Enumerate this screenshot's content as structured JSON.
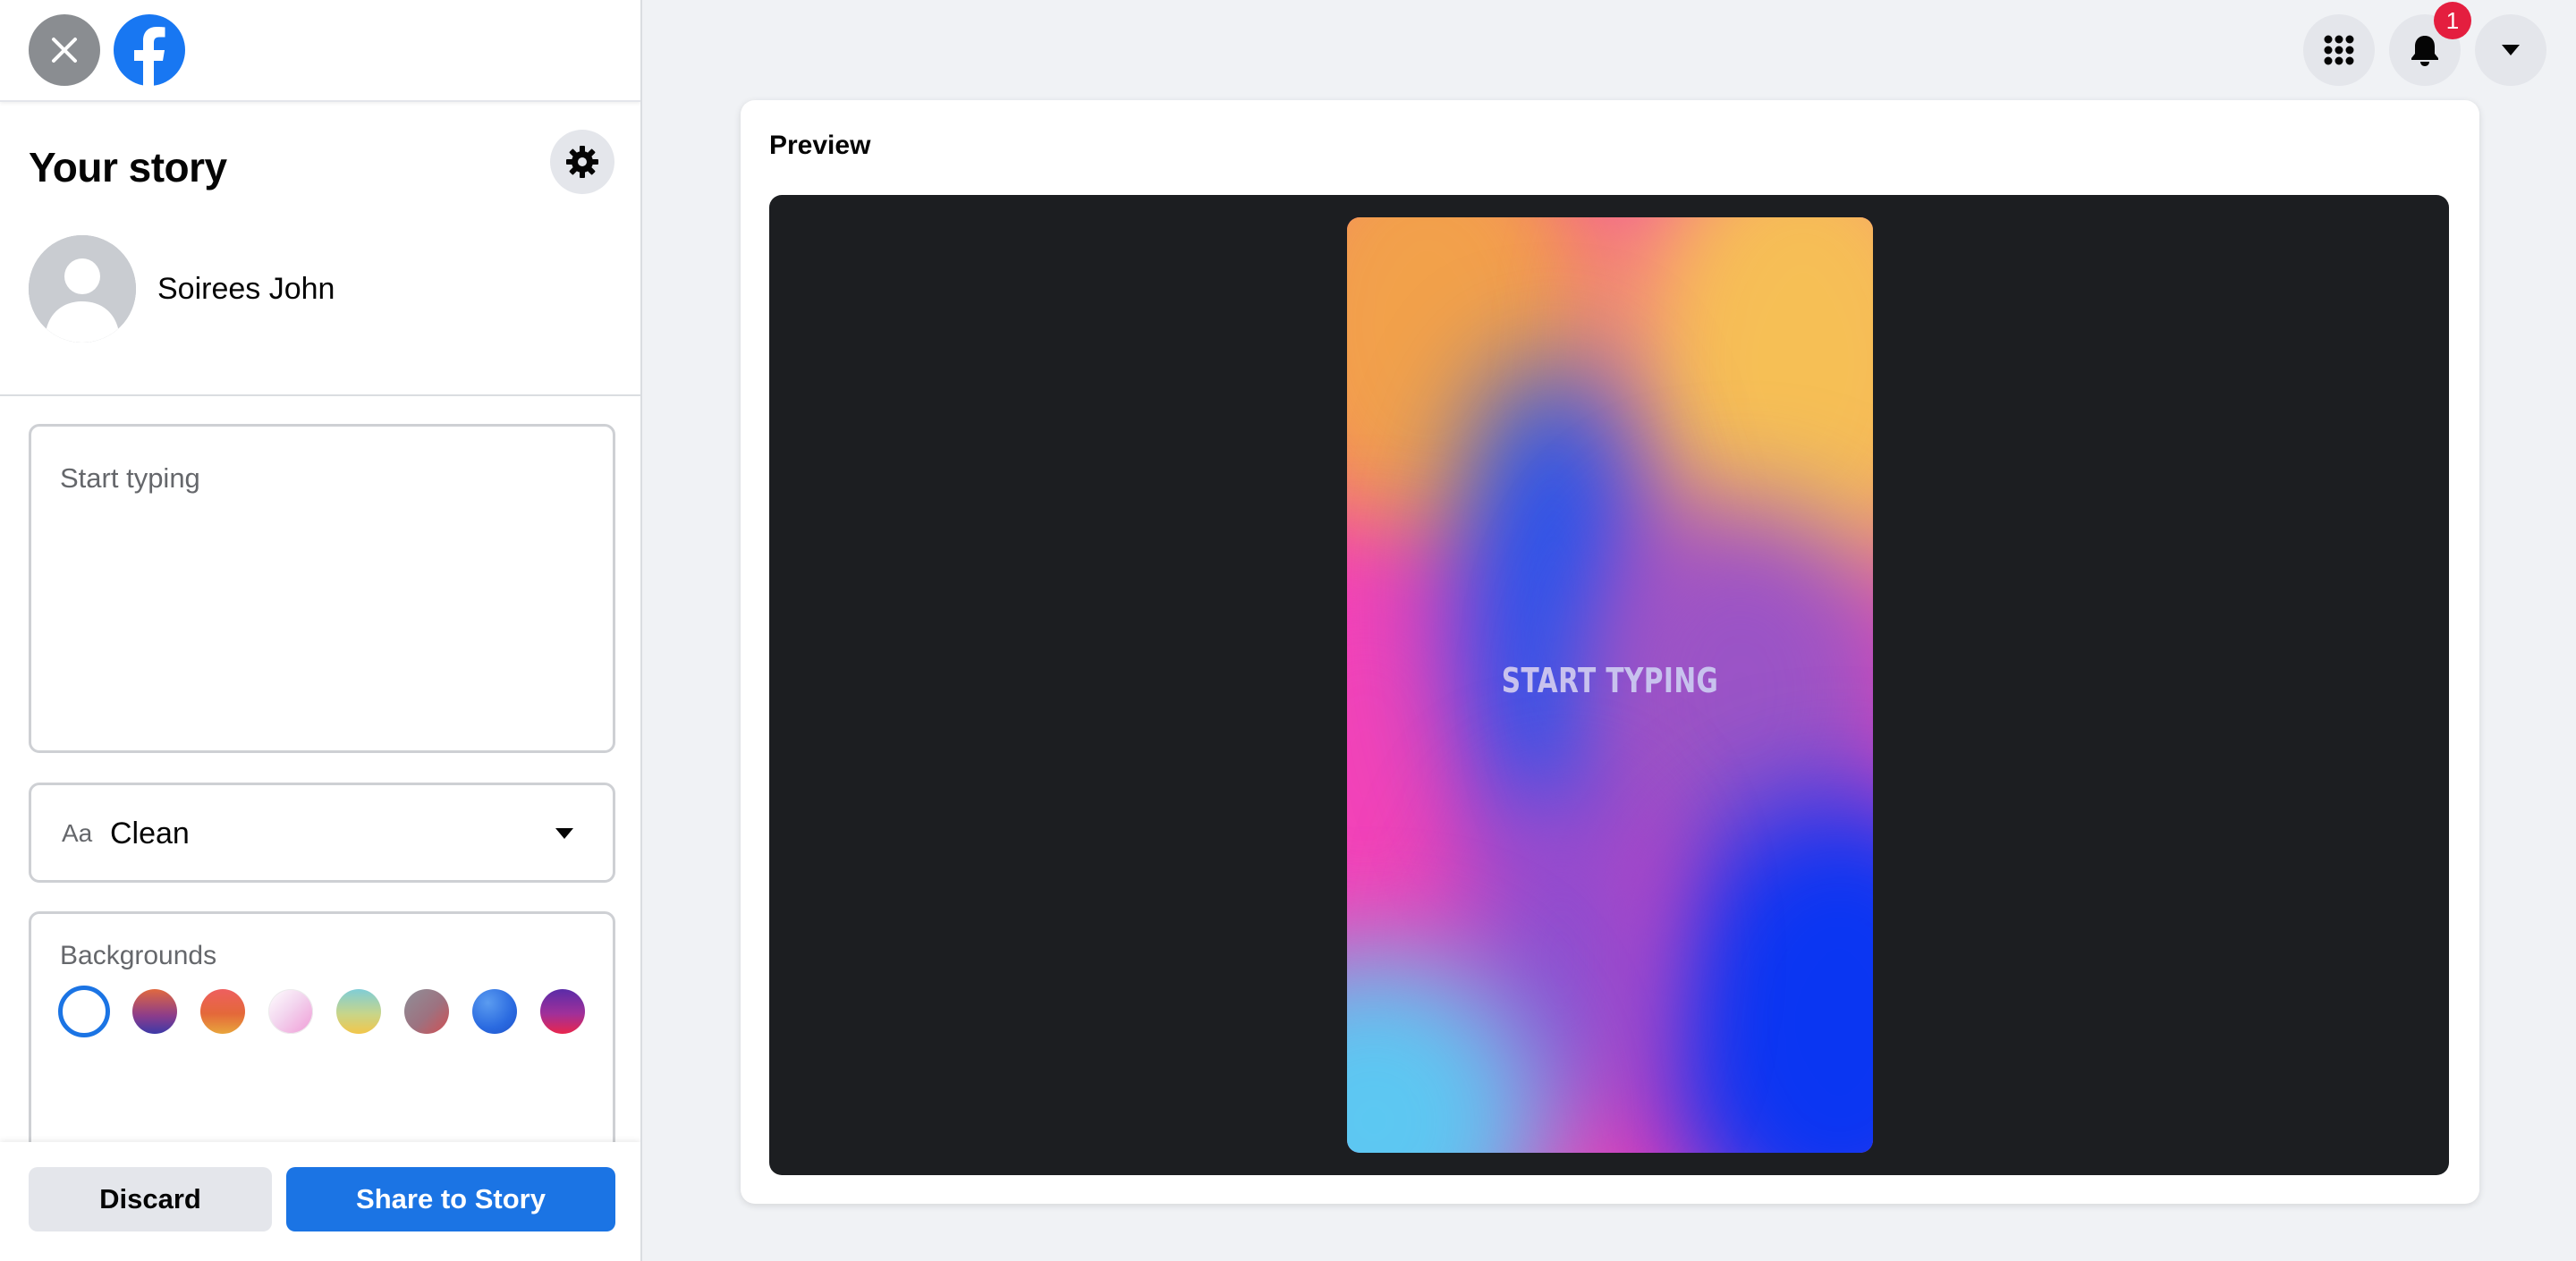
{
  "header": {
    "notification_count": "1"
  },
  "sidebar": {
    "title": "Your story",
    "user_name": "Soirees John",
    "text_placeholder": "Start typing",
    "font_select": {
      "icon_text": "Aa",
      "value": "Clean"
    },
    "backgrounds": {
      "label": "Backgrounds",
      "swatches": [
        "selected-blank",
        "purple-orange",
        "red-orange",
        "white-pink",
        "teal-yellow",
        "gray-red",
        "blue",
        "purple-red"
      ]
    },
    "buttons": {
      "discard": "Discard",
      "share": "Share to Story"
    }
  },
  "preview": {
    "label": "Preview",
    "story_text": "START TYPING"
  },
  "colors": {
    "accent": "#1b74e4",
    "badge": "#e41e3f",
    "stage": "#1c1e21"
  }
}
